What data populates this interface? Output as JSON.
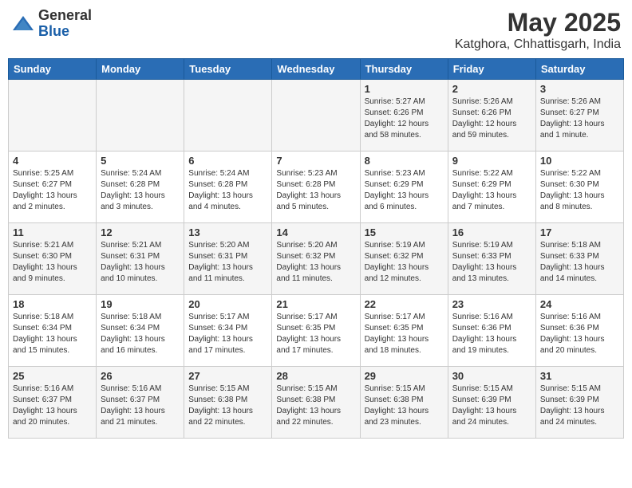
{
  "header": {
    "logo_general": "General",
    "logo_blue": "Blue",
    "month_title": "May 2025",
    "location": "Katghora, Chhattisgarh, India"
  },
  "weekdays": [
    "Sunday",
    "Monday",
    "Tuesday",
    "Wednesday",
    "Thursday",
    "Friday",
    "Saturday"
  ],
  "weeks": [
    [
      {
        "day": "",
        "info": ""
      },
      {
        "day": "",
        "info": ""
      },
      {
        "day": "",
        "info": ""
      },
      {
        "day": "",
        "info": ""
      },
      {
        "day": "1",
        "info": "Sunrise: 5:27 AM\nSunset: 6:26 PM\nDaylight: 12 hours\nand 58 minutes."
      },
      {
        "day": "2",
        "info": "Sunrise: 5:26 AM\nSunset: 6:26 PM\nDaylight: 12 hours\nand 59 minutes."
      },
      {
        "day": "3",
        "info": "Sunrise: 5:26 AM\nSunset: 6:27 PM\nDaylight: 13 hours\nand 1 minute."
      }
    ],
    [
      {
        "day": "4",
        "info": "Sunrise: 5:25 AM\nSunset: 6:27 PM\nDaylight: 13 hours\nand 2 minutes."
      },
      {
        "day": "5",
        "info": "Sunrise: 5:24 AM\nSunset: 6:28 PM\nDaylight: 13 hours\nand 3 minutes."
      },
      {
        "day": "6",
        "info": "Sunrise: 5:24 AM\nSunset: 6:28 PM\nDaylight: 13 hours\nand 4 minutes."
      },
      {
        "day": "7",
        "info": "Sunrise: 5:23 AM\nSunset: 6:28 PM\nDaylight: 13 hours\nand 5 minutes."
      },
      {
        "day": "8",
        "info": "Sunrise: 5:23 AM\nSunset: 6:29 PM\nDaylight: 13 hours\nand 6 minutes."
      },
      {
        "day": "9",
        "info": "Sunrise: 5:22 AM\nSunset: 6:29 PM\nDaylight: 13 hours\nand 7 minutes."
      },
      {
        "day": "10",
        "info": "Sunrise: 5:22 AM\nSunset: 6:30 PM\nDaylight: 13 hours\nand 8 minutes."
      }
    ],
    [
      {
        "day": "11",
        "info": "Sunrise: 5:21 AM\nSunset: 6:30 PM\nDaylight: 13 hours\nand 9 minutes."
      },
      {
        "day": "12",
        "info": "Sunrise: 5:21 AM\nSunset: 6:31 PM\nDaylight: 13 hours\nand 10 minutes."
      },
      {
        "day": "13",
        "info": "Sunrise: 5:20 AM\nSunset: 6:31 PM\nDaylight: 13 hours\nand 11 minutes."
      },
      {
        "day": "14",
        "info": "Sunrise: 5:20 AM\nSunset: 6:32 PM\nDaylight: 13 hours\nand 11 minutes."
      },
      {
        "day": "15",
        "info": "Sunrise: 5:19 AM\nSunset: 6:32 PM\nDaylight: 13 hours\nand 12 minutes."
      },
      {
        "day": "16",
        "info": "Sunrise: 5:19 AM\nSunset: 6:33 PM\nDaylight: 13 hours\nand 13 minutes."
      },
      {
        "day": "17",
        "info": "Sunrise: 5:18 AM\nSunset: 6:33 PM\nDaylight: 13 hours\nand 14 minutes."
      }
    ],
    [
      {
        "day": "18",
        "info": "Sunrise: 5:18 AM\nSunset: 6:34 PM\nDaylight: 13 hours\nand 15 minutes."
      },
      {
        "day": "19",
        "info": "Sunrise: 5:18 AM\nSunset: 6:34 PM\nDaylight: 13 hours\nand 16 minutes."
      },
      {
        "day": "20",
        "info": "Sunrise: 5:17 AM\nSunset: 6:34 PM\nDaylight: 13 hours\nand 17 minutes."
      },
      {
        "day": "21",
        "info": "Sunrise: 5:17 AM\nSunset: 6:35 PM\nDaylight: 13 hours\nand 17 minutes."
      },
      {
        "day": "22",
        "info": "Sunrise: 5:17 AM\nSunset: 6:35 PM\nDaylight: 13 hours\nand 18 minutes."
      },
      {
        "day": "23",
        "info": "Sunrise: 5:16 AM\nSunset: 6:36 PM\nDaylight: 13 hours\nand 19 minutes."
      },
      {
        "day": "24",
        "info": "Sunrise: 5:16 AM\nSunset: 6:36 PM\nDaylight: 13 hours\nand 20 minutes."
      }
    ],
    [
      {
        "day": "25",
        "info": "Sunrise: 5:16 AM\nSunset: 6:37 PM\nDaylight: 13 hours\nand 20 minutes."
      },
      {
        "day": "26",
        "info": "Sunrise: 5:16 AM\nSunset: 6:37 PM\nDaylight: 13 hours\nand 21 minutes."
      },
      {
        "day": "27",
        "info": "Sunrise: 5:15 AM\nSunset: 6:38 PM\nDaylight: 13 hours\nand 22 minutes."
      },
      {
        "day": "28",
        "info": "Sunrise: 5:15 AM\nSunset: 6:38 PM\nDaylight: 13 hours\nand 22 minutes."
      },
      {
        "day": "29",
        "info": "Sunrise: 5:15 AM\nSunset: 6:38 PM\nDaylight: 13 hours\nand 23 minutes."
      },
      {
        "day": "30",
        "info": "Sunrise: 5:15 AM\nSunset: 6:39 PM\nDaylight: 13 hours\nand 24 minutes."
      },
      {
        "day": "31",
        "info": "Sunrise: 5:15 AM\nSunset: 6:39 PM\nDaylight: 13 hours\nand 24 minutes."
      }
    ]
  ]
}
